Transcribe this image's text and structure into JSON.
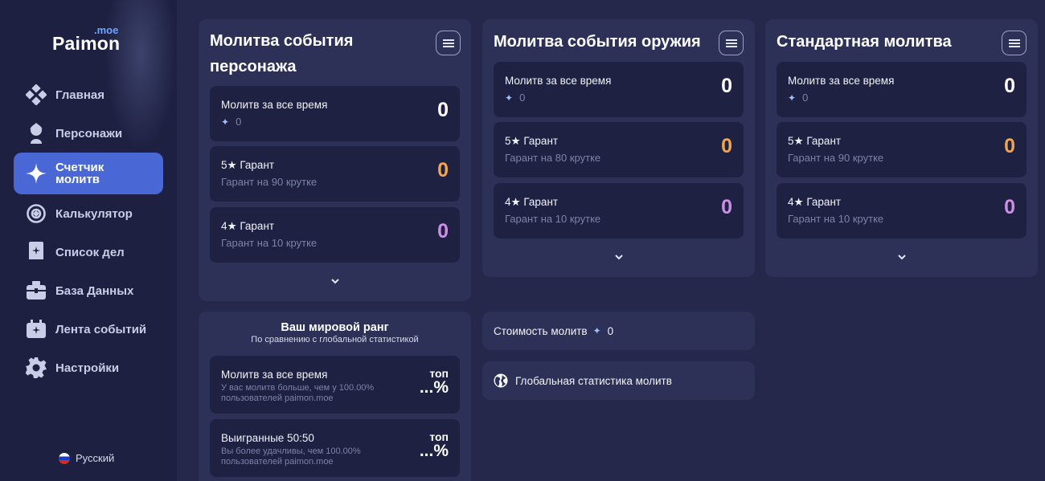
{
  "app": {
    "logo_main": "Paimon",
    "logo_sub": ".moe"
  },
  "sidebar": {
    "items": [
      {
        "label": "Главная",
        "icon": "diamond-grid-icon"
      },
      {
        "label": "Персонажи",
        "icon": "character-icon"
      },
      {
        "label": "Счетчик молитв",
        "icon": "sparkle-icon",
        "active": true
      },
      {
        "label": "Калькулятор",
        "icon": "target-icon"
      },
      {
        "label": "Список дел",
        "icon": "todo-book-icon"
      },
      {
        "label": "База Данных",
        "icon": "database-chest-icon"
      },
      {
        "label": "Лента событий",
        "icon": "events-icon"
      },
      {
        "label": "Настройки",
        "icon": "gear-icon"
      }
    ],
    "language": "Русский"
  },
  "panels": [
    {
      "title": "Молитва события персонажа",
      "stats": [
        {
          "title": "Молитв за все время",
          "sub": "0",
          "value": "0"
        },
        {
          "title": "5★ Гарант",
          "sub": "Гарант на 90 крутке",
          "value": "0"
        },
        {
          "title": "4★ Гарант",
          "sub": "Гарант на 10 крутке",
          "value": "0"
        }
      ]
    },
    {
      "title": "Молитва события оружия",
      "stats": [
        {
          "title": "Молитв за все время",
          "sub": "0",
          "value": "0"
        },
        {
          "title": "5★ Гарант",
          "sub": "Гарант на 80 крутке",
          "value": "0"
        },
        {
          "title": "4★ Гарант",
          "sub": "Гарант на 10 крутке",
          "value": "0"
        }
      ]
    },
    {
      "title": "Стандартная молитва",
      "stats": [
        {
          "title": "Молитв за все время",
          "sub": "0",
          "value": "0"
        },
        {
          "title": "5★ Гарант",
          "sub": "Гарант на 90 крутке",
          "value": "0"
        },
        {
          "title": "4★ Гарант",
          "sub": "Гарант на 10 крутке",
          "value": "0"
        }
      ]
    }
  ],
  "rank": {
    "title": "Ваш мировой ранг",
    "subtitle": "По сравнению с глобальной статистикой",
    "items": [
      {
        "title": "Молитв за все время",
        "desc": "У вас молитв больше, чем у 100.00% пользователей paimon.moe",
        "top_label": "топ",
        "top_value": "...%"
      },
      {
        "title": "Выигранные 50:50",
        "desc": "Вы более удачливы, чем 100.00% пользователей paimon.moe",
        "top_label": "топ",
        "top_value": "...%"
      }
    ]
  },
  "cost": {
    "label": "Стоимость молитв",
    "value": "0"
  },
  "global_stats": {
    "label": "Глобальная статистика молитв"
  },
  "colors": {
    "background": "#25284a",
    "sidebar": "#1d2040",
    "panel": "#2d3158",
    "card": "#1e2142",
    "active_nav": "#4a67d6",
    "five_star": "#f3a54d",
    "four_star": "#cf8ee6"
  }
}
